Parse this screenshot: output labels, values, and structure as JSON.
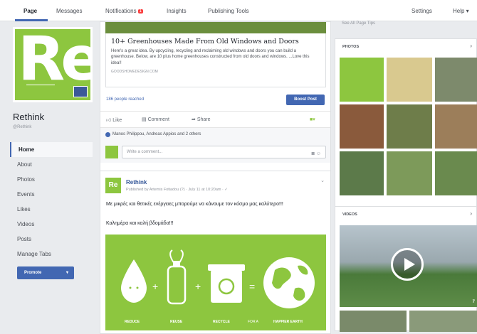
{
  "nav": {
    "tabs": [
      "Page",
      "Messages",
      "Notifications",
      "Insights",
      "Publishing Tools"
    ],
    "notifications_count": "1",
    "settings": "Settings",
    "help": "Help ▾"
  },
  "page": {
    "name": "Rethink",
    "handle": "@Rethink",
    "logo_text": "Re"
  },
  "sidebar": {
    "items": [
      "Home",
      "About",
      "Photos",
      "Events",
      "Likes",
      "Videos",
      "Posts",
      "Manage Tabs"
    ],
    "promote": "Promote"
  },
  "link_post": {
    "title": "10+ Greenhouses Made From Old Windows and Doors",
    "description": "Here's a great idea. By upcycling, recycling and reclaiming old windows and doors you can build a greenhouse. Below, are 10 plus home greenhouses constructed from old doors and windows. ...Love this idea!!",
    "domain": "GOODSHOMEDESIGN.COM",
    "reach": "186 people reached",
    "boost": "Boost Post",
    "actions": [
      "Like",
      "Comment",
      "Share"
    ],
    "likers": "Manos Philippou, Andreas Appios and 2 others",
    "comment_placeholder": "Write a comment..."
  },
  "post": {
    "author": "Rethink",
    "meta": "Published by Artemis Fotiadou (?) · July 11 at 10:20am · ✓",
    "text": "Με μικρές και θετικές ενέργειες μπορούμε να κάνουμε τον κόσμο μας καλύτερο!!!",
    "text2": "Καλημέρα και καλή βδομάδα!!!",
    "image_labels": [
      "REDUCE",
      "REUSE",
      "RECYCLE",
      "FOR A",
      "HAPPIER EARTH"
    ]
  },
  "right": {
    "see_tips": "See All Page Tips",
    "photos_header": "PHOTOS",
    "videos_header": "VIDEOS",
    "video_count": "7"
  },
  "colors": {
    "brand_green": "#8dc63f",
    "fb_blue": "#4267b2",
    "background": "#e9ebee"
  }
}
